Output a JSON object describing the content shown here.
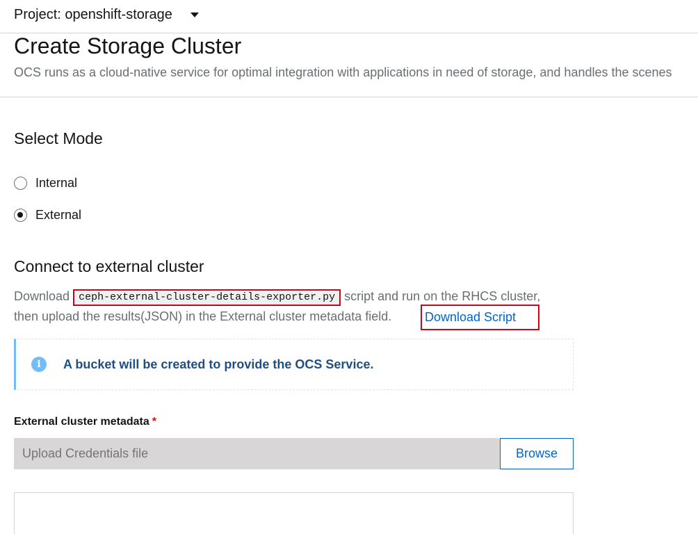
{
  "project": {
    "label": "Project: openshift-storage"
  },
  "page": {
    "title": "Create Storage Cluster",
    "description": "OCS runs as a cloud-native service for optimal integration with applications in need of storage, and handles the scenes"
  },
  "mode": {
    "title": "Select Mode",
    "options": [
      {
        "label": "Internal",
        "checked": false
      },
      {
        "label": "External",
        "checked": true
      }
    ]
  },
  "connect": {
    "title": "Connect to external cluster",
    "line1_prefix": "Download ",
    "script_name": "ceph-external-cluster-details-exporter.py",
    "line1_suffix": " script and run on the RHCS cluster,",
    "line2": "then upload the results(JSON) in the External cluster metadata field.",
    "download_link": "Download Script"
  },
  "alert": {
    "icon": "info-icon",
    "title": "A bucket will be created to provide the OCS Service."
  },
  "metadata": {
    "label": "External cluster metadata",
    "required_mark": "*",
    "placeholder": "Upload Credentials file",
    "browse_label": "Browse"
  },
  "colors": {
    "link": "#0066cc",
    "highlight_border": "#d0021b",
    "info_accent": "#73bcf7"
  }
}
